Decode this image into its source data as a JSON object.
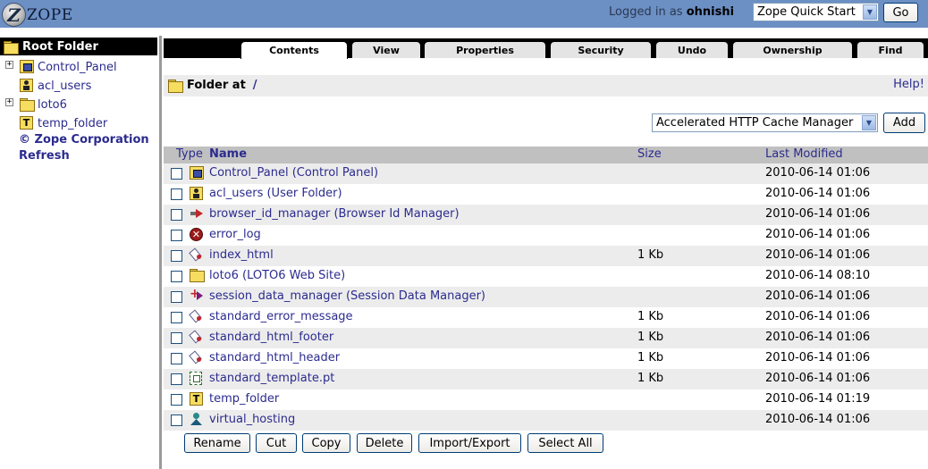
{
  "header": {
    "logo_text": "ZOPE",
    "logged_in_prefix": "Logged in as",
    "username": "ohnishi",
    "quick_start_selected": "Zope Quick Start",
    "go_label": "Go",
    "bg_color": "#6c8fc4"
  },
  "tree": {
    "root_label": "Root Folder",
    "items": [
      {
        "label": "Control_Panel",
        "icon": "control-panel-icon",
        "expandable": true
      },
      {
        "label": "acl_users",
        "icon": "user-folder-icon",
        "expandable": false
      },
      {
        "label": "loto6",
        "icon": "folder-icon",
        "expandable": true
      },
      {
        "label": "temp_folder",
        "icon": "temp-folder-icon",
        "expandable": false
      }
    ],
    "copyright": "© Zope Corporation",
    "refresh": "Refresh"
  },
  "tabs": [
    "Contents",
    "View",
    "Properties",
    "Security",
    "Undo",
    "Ownership",
    "Find"
  ],
  "active_tab": "Contents",
  "breadcrumb": {
    "prefix": "Folder at",
    "path": "/"
  },
  "help_label": "Help!",
  "add": {
    "selected": "Accelerated HTTP Cache Manager",
    "button": "Add"
  },
  "table": {
    "headers": {
      "type": "Type",
      "name": "Name",
      "size": "Size",
      "modified": "Last Modified"
    },
    "rows": [
      {
        "name": "Control_Panel (Control Panel)",
        "size": "",
        "modified": "2010-06-14 01:06",
        "icon": "control-panel-icon"
      },
      {
        "name": "acl_users (User Folder)",
        "size": "",
        "modified": "2010-06-14 01:06",
        "icon": "user-folder-icon"
      },
      {
        "name": "browser_id_manager (Browser Id Manager)",
        "size": "",
        "modified": "2010-06-14 01:06",
        "icon": "browser-id-manager-icon"
      },
      {
        "name": "error_log",
        "size": "",
        "modified": "2010-06-14 01:06",
        "icon": "error-log-icon"
      },
      {
        "name": "index_html",
        "size": "1 Kb",
        "modified": "2010-06-14 01:06",
        "icon": "dtml-method-icon"
      },
      {
        "name": "loto6 (LOTO6 Web Site)",
        "size": "",
        "modified": "2010-06-14 08:10",
        "icon": "folder-icon"
      },
      {
        "name": "session_data_manager (Session Data Manager)",
        "size": "",
        "modified": "2010-06-14 01:06",
        "icon": "session-data-manager-icon"
      },
      {
        "name": "standard_error_message",
        "size": "1 Kb",
        "modified": "2010-06-14 01:06",
        "icon": "dtml-method-icon"
      },
      {
        "name": "standard_html_footer",
        "size": "1 Kb",
        "modified": "2010-06-14 01:06",
        "icon": "dtml-method-icon"
      },
      {
        "name": "standard_html_header",
        "size": "1 Kb",
        "modified": "2010-06-14 01:06",
        "icon": "dtml-method-icon"
      },
      {
        "name": "standard_template.pt",
        "size": "1 Kb",
        "modified": "2010-06-14 01:06",
        "icon": "page-template-icon"
      },
      {
        "name": "temp_folder",
        "size": "",
        "modified": "2010-06-14 01:19",
        "icon": "temp-folder-icon"
      },
      {
        "name": "virtual_hosting",
        "size": "",
        "modified": "2010-06-14 01:06",
        "icon": "virtual-host-monster-icon"
      }
    ]
  },
  "actions": [
    "Rename",
    "Cut",
    "Copy",
    "Delete",
    "Import/Export",
    "Select All"
  ]
}
